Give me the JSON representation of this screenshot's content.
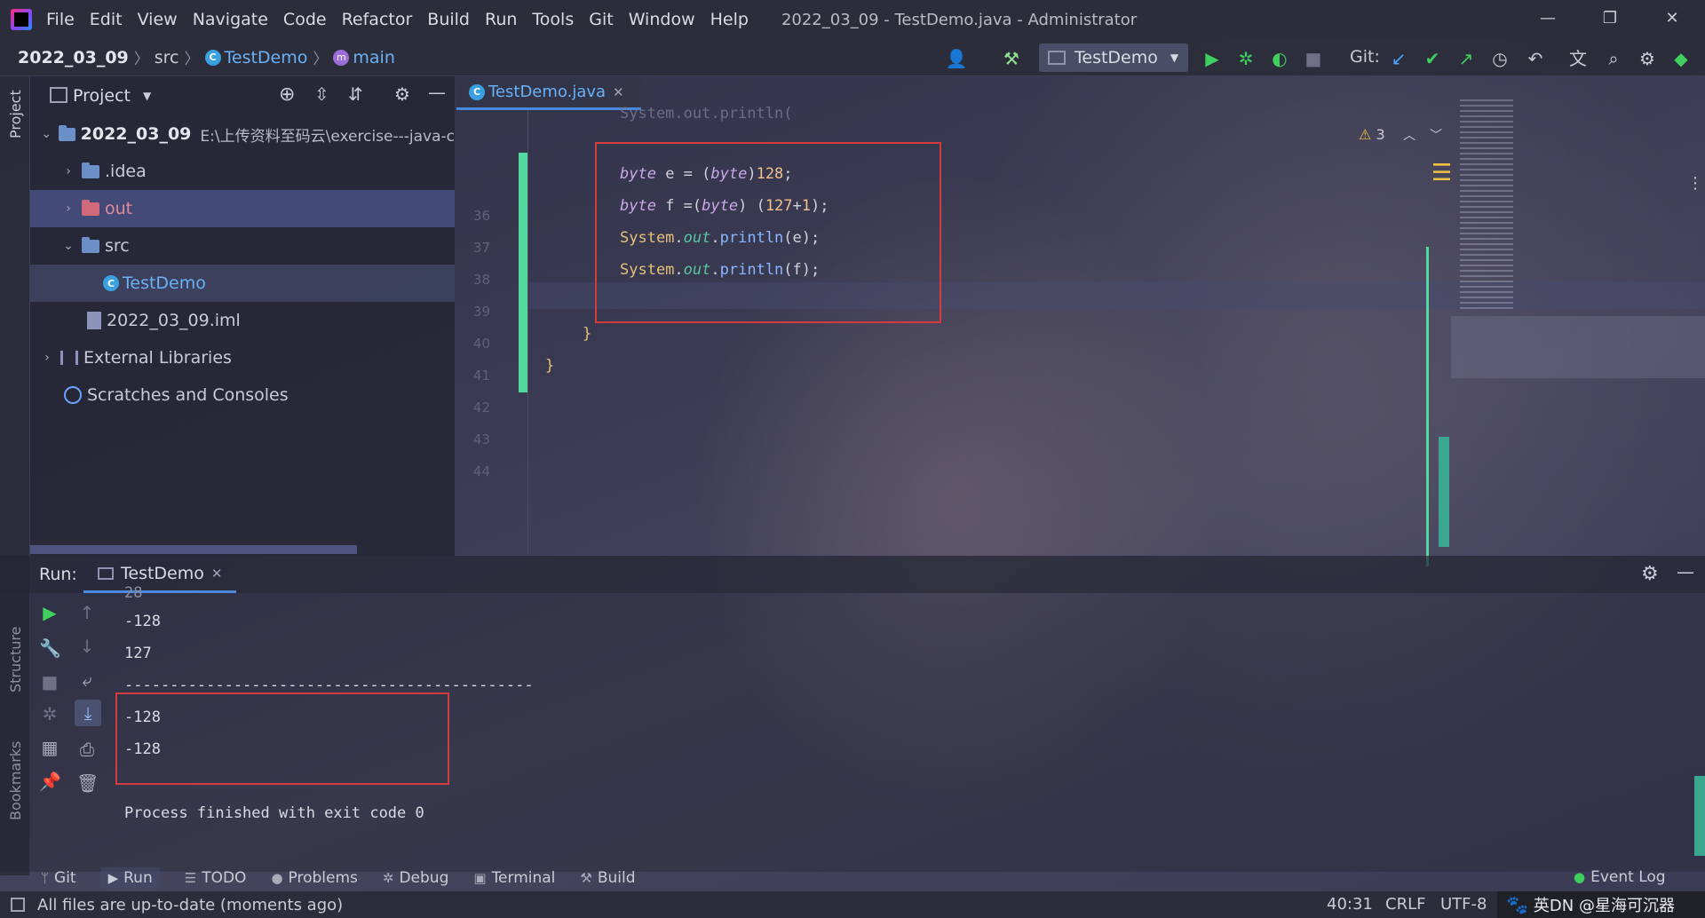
{
  "menubar": {
    "items": [
      "File",
      "Edit",
      "View",
      "Navigate",
      "Code",
      "Refactor",
      "Build",
      "Run",
      "Tools",
      "Git",
      "Window",
      "Help"
    ],
    "window_title": "2022_03_09 - TestDemo.java - Administrator"
  },
  "navbar": {
    "project": "2022_03_09",
    "src": "src",
    "class": "TestDemo",
    "method": "main",
    "run_config": "TestDemo",
    "git_label": "Git:"
  },
  "left_strip": {
    "project_label": "Project",
    "structure_label": "Structure",
    "bookmarks_label": "Bookmarks"
  },
  "project_panel": {
    "title": "Project",
    "tree": [
      {
        "label": "2022_03_09",
        "path": "E:\\上传资料至码云\\exercise---java-c"
      },
      {
        "label": ".idea"
      },
      {
        "label": "out"
      },
      {
        "label": "src"
      },
      {
        "label": "TestDemo"
      },
      {
        "label": "2022_03_09.iml"
      },
      {
        "label": "External Libraries"
      },
      {
        "label": "Scratches and Consoles"
      }
    ]
  },
  "editor": {
    "tab_label": "TestDemo.java",
    "line_numbers": [
      "36",
      "37",
      "38",
      "39",
      "40",
      "41",
      "42",
      "43",
      "44"
    ],
    "partial_top_line": "System.out.println(",
    "warning_count": "3",
    "code": {
      "l37": {
        "kw": "byte",
        "a": " e = (",
        "cast": "byte",
        "b": ")",
        "num": "128",
        "c": ";"
      },
      "l38": {
        "kw": "byte",
        "a": " f =(",
        "cast": "byte",
        "b": ") (",
        "n1": "127",
        "op": "+",
        "n2": "1",
        "c": ");"
      },
      "l39": {
        "sys": "System",
        "dot1": ".",
        "out": "out",
        "dot2": ".",
        "m": "println",
        "args": "(e);"
      },
      "l40": {
        "sys": "System",
        "dot1": ".",
        "out": "out",
        "dot2": ".",
        "m": "println",
        "args": "(f);"
      },
      "l42": "}",
      "l43": "}"
    }
  },
  "run_panel": {
    "label": "Run:",
    "tab_label": "TestDemo",
    "output": [
      "-128",
      "127",
      "---------------------------------------------",
      "-128",
      "-128",
      "",
      "Process finished with exit code 0"
    ],
    "partial_top": "28"
  },
  "tool_tabs": [
    "Git",
    "Run",
    "TODO",
    "Problems",
    "Debug",
    "Terminal",
    "Build"
  ],
  "event_log": "Event Log",
  "status": {
    "message": "All files are up-to-date (moments ago)",
    "position": "40:31",
    "line_sep": "CRLF",
    "encoding": "UTF-8",
    "watermark": "英DN @星海可沉器"
  }
}
